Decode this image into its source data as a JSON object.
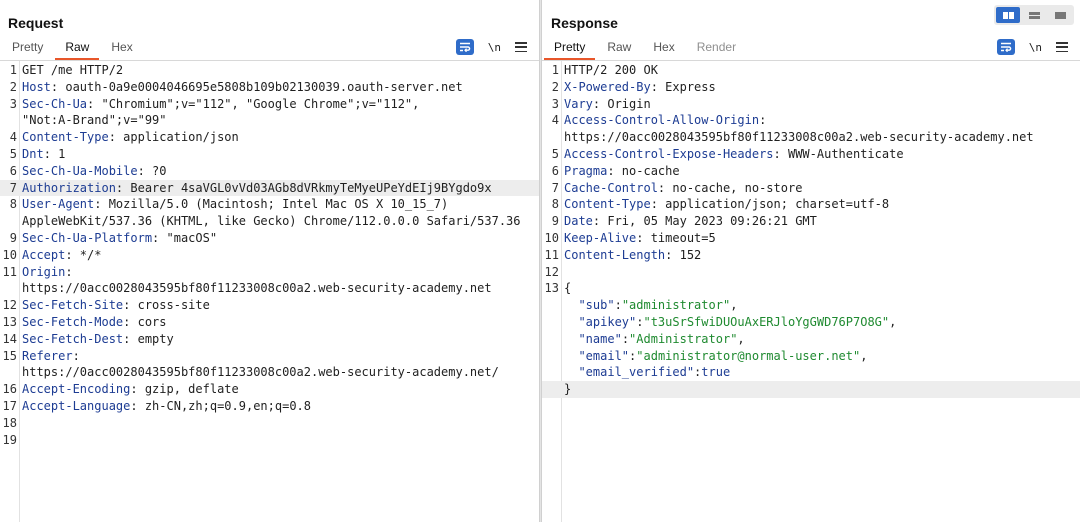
{
  "request": {
    "title": "Request",
    "tabs": [
      {
        "label": "Pretty",
        "state": "normal"
      },
      {
        "label": "Raw",
        "state": "active"
      },
      {
        "label": "Hex",
        "state": "normal"
      }
    ],
    "newline_label": "\\n",
    "lines": [
      {
        "n": "1",
        "parts": [
          {
            "t": "GET /me HTTP/2"
          }
        ]
      },
      {
        "n": "2",
        "parts": [
          {
            "t": "Host",
            "c": "hk"
          },
          {
            "t": ": oauth-0a9e0004046695e5808b109b02130039.oauth-server.net"
          }
        ]
      },
      {
        "n": "3",
        "parts": [
          {
            "t": "Sec-Ch-Ua",
            "c": "hk"
          },
          {
            "t": ": \"Chromium\";v=\"112\", \"Google Chrome\";v=\"112\","
          }
        ]
      },
      {
        "n": "",
        "parts": [
          {
            "t": "\"Not:A-Brand\";v=\"99\""
          }
        ]
      },
      {
        "n": "4",
        "parts": [
          {
            "t": "Content-Type",
            "c": "hk"
          },
          {
            "t": ": application/json"
          }
        ]
      },
      {
        "n": "5",
        "parts": [
          {
            "t": "Dnt",
            "c": "hk"
          },
          {
            "t": ": 1"
          }
        ]
      },
      {
        "n": "6",
        "parts": [
          {
            "t": "Sec-Ch-Ua-Mobile",
            "c": "hk"
          },
          {
            "t": ": ?0"
          }
        ]
      },
      {
        "n": "7",
        "hl": true,
        "parts": [
          {
            "t": "Authorization",
            "c": "hk"
          },
          {
            "t": ": Bearer 4saVGL0vVd03AGb8dVRkmyTeMyeUPeYdEIj9BYgdo9x"
          }
        ]
      },
      {
        "n": "8",
        "parts": [
          {
            "t": "User-Agent",
            "c": "hk"
          },
          {
            "t": ": Mozilla/5.0 (Macintosh; Intel Mac OS X 10_15_7)"
          }
        ]
      },
      {
        "n": "",
        "parts": [
          {
            "t": "AppleWebKit/537.36 (KHTML, like Gecko) Chrome/112.0.0.0 Safari/537.36"
          }
        ]
      },
      {
        "n": "9",
        "parts": [
          {
            "t": "Sec-Ch-Ua-Platform",
            "c": "hk"
          },
          {
            "t": ": \"macOS\""
          }
        ]
      },
      {
        "n": "10",
        "parts": [
          {
            "t": "Accept",
            "c": "hk"
          },
          {
            "t": ": */*"
          }
        ]
      },
      {
        "n": "11",
        "parts": [
          {
            "t": "Origin",
            "c": "hk"
          },
          {
            "t": ":"
          }
        ]
      },
      {
        "n": "",
        "parts": [
          {
            "t": "https://0acc0028043595bf80f11233008c00a2.web-security-academy.net"
          }
        ]
      },
      {
        "n": "12",
        "parts": [
          {
            "t": "Sec-Fetch-Site",
            "c": "hk"
          },
          {
            "t": ": cross-site"
          }
        ]
      },
      {
        "n": "13",
        "parts": [
          {
            "t": "Sec-Fetch-Mode",
            "c": "hk"
          },
          {
            "t": ": cors"
          }
        ]
      },
      {
        "n": "14",
        "parts": [
          {
            "t": "Sec-Fetch-Dest",
            "c": "hk"
          },
          {
            "t": ": empty"
          }
        ]
      },
      {
        "n": "15",
        "parts": [
          {
            "t": "Referer",
            "c": "hk"
          },
          {
            "t": ":"
          }
        ]
      },
      {
        "n": "",
        "parts": [
          {
            "t": "https://0acc0028043595bf80f11233008c00a2.web-security-academy.net/"
          }
        ]
      },
      {
        "n": "16",
        "parts": [
          {
            "t": "Accept-Encoding",
            "c": "hk"
          },
          {
            "t": ": gzip, deflate"
          }
        ]
      },
      {
        "n": "17",
        "parts": [
          {
            "t": "Accept-Language",
            "c": "hk"
          },
          {
            "t": ": zh-CN,zh;q=0.9,en;q=0.8"
          }
        ]
      },
      {
        "n": "18",
        "parts": []
      },
      {
        "n": "19",
        "parts": []
      }
    ]
  },
  "response": {
    "title": "Response",
    "tabs": [
      {
        "label": "Pretty",
        "state": "active"
      },
      {
        "label": "Raw",
        "state": "normal"
      },
      {
        "label": "Hex",
        "state": "normal"
      },
      {
        "label": "Render",
        "state": "disabled"
      }
    ],
    "newline_label": "\\n",
    "lines": [
      {
        "n": "1",
        "parts": [
          {
            "t": "HTTP/2 200 OK"
          }
        ]
      },
      {
        "n": "2",
        "parts": [
          {
            "t": "X-Powered-By",
            "c": "hk"
          },
          {
            "t": ": Express"
          }
        ]
      },
      {
        "n": "3",
        "parts": [
          {
            "t": "Vary",
            "c": "hk"
          },
          {
            "t": ": Origin"
          }
        ]
      },
      {
        "n": "4",
        "parts": [
          {
            "t": "Access-Control-Allow-Origin",
            "c": "hk"
          },
          {
            "t": ":"
          }
        ]
      },
      {
        "n": "",
        "parts": [
          {
            "t": "https://0acc0028043595bf80f11233008c00a2.web-security-academy.net"
          }
        ]
      },
      {
        "n": "5",
        "parts": [
          {
            "t": "Access-Control-Expose-Headers",
            "c": "hk"
          },
          {
            "t": ": WWW-Authenticate"
          }
        ]
      },
      {
        "n": "6",
        "parts": [
          {
            "t": "Pragma",
            "c": "hk"
          },
          {
            "t": ": no-cache"
          }
        ]
      },
      {
        "n": "7",
        "parts": [
          {
            "t": "Cache-Control",
            "c": "hk"
          },
          {
            "t": ": no-cache, no-store"
          }
        ]
      },
      {
        "n": "8",
        "parts": [
          {
            "t": "Content-Type",
            "c": "hk"
          },
          {
            "t": ": application/json; charset=utf-8"
          }
        ]
      },
      {
        "n": "9",
        "parts": [
          {
            "t": "Date",
            "c": "hk"
          },
          {
            "t": ": Fri, 05 May 2023 09:26:21 GMT"
          }
        ]
      },
      {
        "n": "10",
        "parts": [
          {
            "t": "Keep-Alive",
            "c": "hk"
          },
          {
            "t": ": timeout=5"
          }
        ]
      },
      {
        "n": "11",
        "parts": [
          {
            "t": "Content-Length",
            "c": "hk"
          },
          {
            "t": ": 152"
          }
        ]
      },
      {
        "n": "12",
        "parts": []
      },
      {
        "n": "13",
        "parts": [
          {
            "t": "{"
          }
        ]
      },
      {
        "n": "",
        "parts": [
          {
            "t": "  "
          },
          {
            "t": "\"sub\"",
            "c": "jk"
          },
          {
            "t": ":"
          },
          {
            "t": "\"administrator\"",
            "c": "js"
          },
          {
            "t": ","
          }
        ]
      },
      {
        "n": "",
        "parts": [
          {
            "t": "  "
          },
          {
            "t": "\"apikey\"",
            "c": "jk"
          },
          {
            "t": ":"
          },
          {
            "t": "\"t3uSrSfwiDUOuAxERJloYgGWD76P7O8G\"",
            "c": "js"
          },
          {
            "t": ","
          }
        ]
      },
      {
        "n": "",
        "parts": [
          {
            "t": "  "
          },
          {
            "t": "\"name\"",
            "c": "jk"
          },
          {
            "t": ":"
          },
          {
            "t": "\"Administrator\"",
            "c": "js"
          },
          {
            "t": ","
          }
        ]
      },
      {
        "n": "",
        "parts": [
          {
            "t": "  "
          },
          {
            "t": "\"email\"",
            "c": "jk"
          },
          {
            "t": ":"
          },
          {
            "t": "\"administrator@normal-user.net\"",
            "c": "js"
          },
          {
            "t": ","
          }
        ]
      },
      {
        "n": "",
        "parts": [
          {
            "t": "  "
          },
          {
            "t": "\"email_verified\"",
            "c": "jk"
          },
          {
            "t": ":"
          },
          {
            "t": "true",
            "c": "jb"
          }
        ]
      },
      {
        "n": "",
        "hl": true,
        "parts": [
          {
            "t": "}"
          }
        ]
      }
    ]
  },
  "colors": {
    "accent_tab": "#e8562a",
    "header_key": "#1d3c93",
    "json_string": "#1f8a30",
    "button_blue": "#2f6cc9"
  },
  "icons": {
    "wrap": "word-wrap-icon",
    "menu": "hamburger-menu-icon",
    "layout": [
      "layout-side-by-side-icon",
      "layout-stacked-icon",
      "layout-single-icon"
    ]
  }
}
